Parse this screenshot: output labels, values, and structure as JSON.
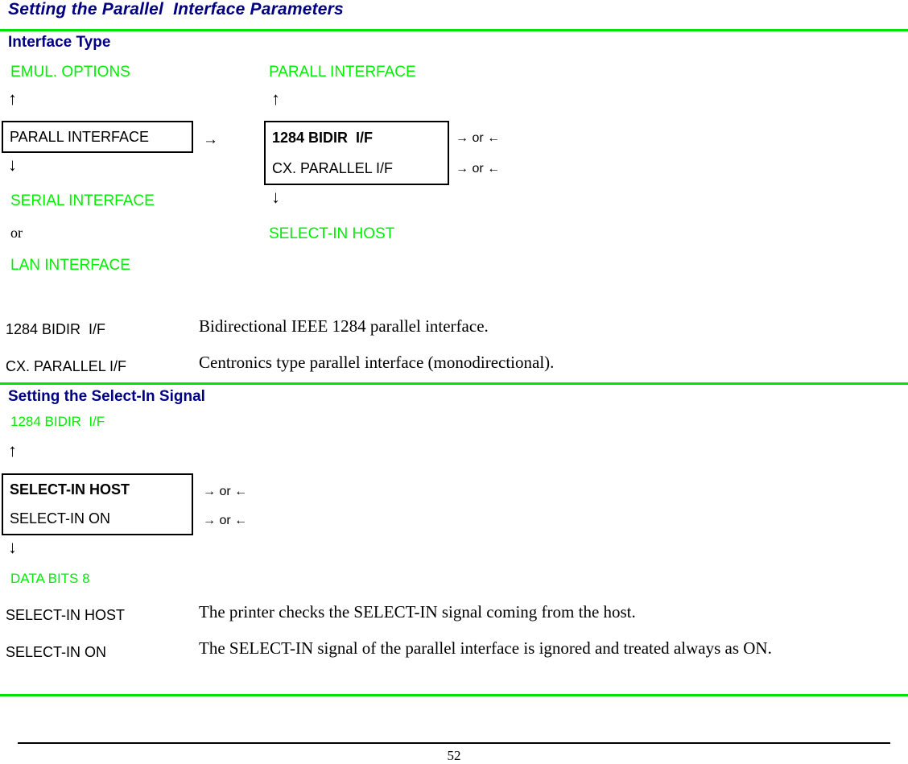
{
  "document": {
    "title": "Setting the Parallel  Interface Parameters",
    "page_number": "52",
    "accent_green": "#00ee00",
    "heading_navy": "#000080"
  },
  "section_interface_type": {
    "heading": "Interface Type",
    "left_column": {
      "above_label": "EMUL. OPTIONS",
      "up_arrow": "↑",
      "box_row": "PARALL INTERFACE",
      "down_arrow": "↓",
      "below_label_1": "SERIAL INTERFACE",
      "or_text": "or",
      "below_label_2": "LAN INTERFACE",
      "connector_arrow": "→"
    },
    "right_column": {
      "above_label": "PARALL INTERFACE",
      "up_arrow": "↑",
      "box_row_1": "1284 BIDIR  I/F",
      "box_row_2": "CX. PARALLEL I/F",
      "select_arrow_1": "→ or ←",
      "select_arrow_2": "→ or ←",
      "down_arrow": "↓",
      "below_label": "SELECT-IN HOST"
    },
    "definitions": [
      {
        "term": "1284 BIDIR  I/F",
        "description": "Bidirectional IEEE 1284 parallel interface."
      },
      {
        "term": "CX. PARALLEL I/F",
        "description": "Centronics type parallel interface (monodirectional)."
      }
    ]
  },
  "section_select_in": {
    "heading": "Setting the Select-In Signal",
    "diagram": {
      "above_label": "1284 BIDIR  I/F",
      "up_arrow": "↑",
      "box_row_1": "SELECT-IN HOST",
      "box_row_2": "SELECT-IN ON",
      "select_arrow_1": "→ or ←",
      "select_arrow_2": "→ or ←",
      "down_arrow": "↓",
      "below_label": "DATA BITS 8"
    },
    "definitions": [
      {
        "term": "SELECT-IN HOST",
        "description": "The printer checks the SELECT-IN signal coming from the host."
      },
      {
        "term": "SELECT-IN ON",
        "description": "The SELECT-IN signal of the parallel interface is ignored and treated always as ON."
      }
    ]
  }
}
